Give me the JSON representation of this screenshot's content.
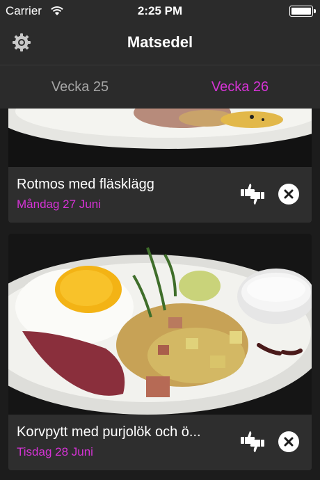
{
  "status_bar": {
    "carrier": "Carrier",
    "time": "2:25 PM",
    "battery_level": 1.0
  },
  "nav": {
    "title": "Matsedel",
    "settings_icon": "gear-icon"
  },
  "tabs": [
    {
      "label": "Vecka 25",
      "active": false
    },
    {
      "label": "Vecka 26",
      "active": true
    }
  ],
  "colors": {
    "accent": "#d633d6",
    "background": "#1c1c1c",
    "bar": "#2b2b2b",
    "card": "#2e2e2e",
    "inactive_tab": "#a6a6a6"
  },
  "meals": [
    {
      "title": "Rotmos med fläsklägg",
      "date": "Måndag 27 Juni",
      "rate_icon": "thumbs-up-down-icon",
      "remove_icon": "close-icon"
    },
    {
      "title": "Korvpytt med purjolök och ö...",
      "date": "Tisdag 28 Juni",
      "rate_icon": "thumbs-up-down-icon",
      "remove_icon": "close-icon"
    }
  ]
}
